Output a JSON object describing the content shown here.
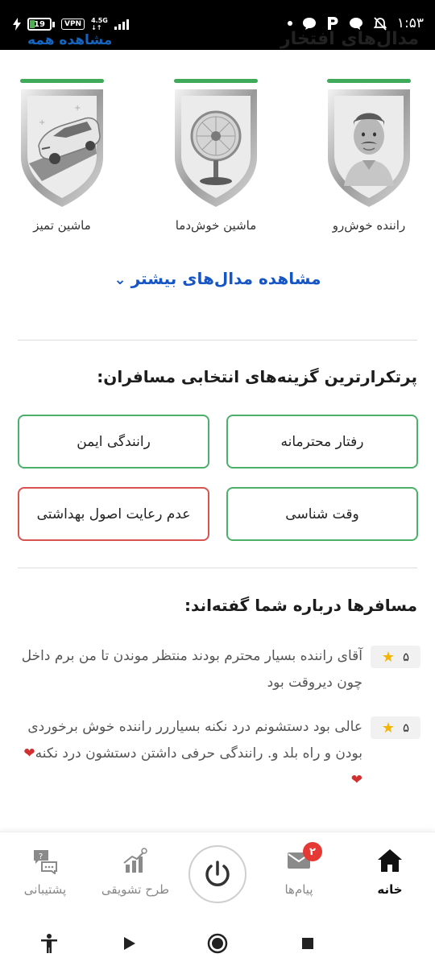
{
  "status_bar": {
    "battery_level": "19",
    "vpn": "VPN",
    "network_type": "4.5G",
    "network_sub": "↓↑",
    "time": "۱:۵۳"
  },
  "header": {
    "title": "مدال‌های افتخار",
    "link": "مشاهده همه"
  },
  "medals": [
    {
      "label": "راننده خوش‌رو",
      "progress_percent": 100,
      "icon": "driver-face-icon"
    },
    {
      "label": "ماشین خوش‌دما",
      "progress_percent": 100,
      "icon": "fan-icon"
    },
    {
      "label": "ماشین تمیز",
      "progress_percent": 100,
      "icon": "clean-car-icon"
    }
  ],
  "more_medals": {
    "label": "مشاهده مدال‌های بیشتر",
    "icon": "chevron-down-icon"
  },
  "choices": {
    "title": "پرتکرارترین گزینه‌های انتخابی مسافران:",
    "items": [
      {
        "label": "رفتار محترمانه",
        "sentiment": "positive"
      },
      {
        "label": "رانندگی ایمن",
        "sentiment": "positive"
      },
      {
        "label": "وقت شناسی",
        "sentiment": "positive"
      },
      {
        "label": "عدم رعایت اصول بهداشتی",
        "sentiment": "negative"
      }
    ]
  },
  "reviews": {
    "title": "مسافرها درباره شما گفته‌اند:",
    "items": [
      {
        "rating": "۵",
        "text": "آقای راننده بسیار محترم بودند منتظر موندن تا من برم داخل چون دیروقت بود",
        "hearts": ""
      },
      {
        "rating": "۵",
        "text": "عالی بود دستشونم درد نکنه بسیاررر راننده خوش برخوردی بودن و راه بلد و. رانندگی حرفی داشتن دستشون درد نکنه",
        "hearts": "❤❤"
      }
    ]
  },
  "bottom_nav": {
    "home": "خانه",
    "messages": "پیام‌ها",
    "messages_badge": "۲",
    "incentive": "طرح تشویقی",
    "support": "پشتیبانی"
  },
  "colors": {
    "accent_green": "#4caf6a",
    "negative_red": "#d9534f",
    "link_blue": "#1655c4",
    "badge_red": "#e53935",
    "star_gold": "#f4b400"
  }
}
